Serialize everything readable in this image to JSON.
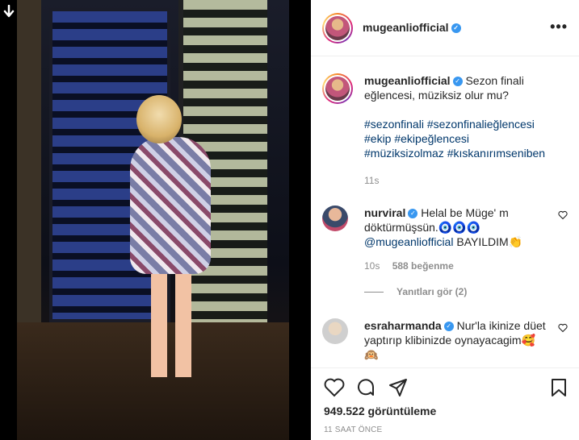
{
  "post": {
    "username": "mugeanliofficial",
    "more_label": "•••"
  },
  "caption": {
    "username": "mugeanliofficial",
    "text": "Sezon finali eğlencesi, müziksiz olur mu?",
    "hashtags": "#sezonfinali #sezonfinalieğlencesi #ekip #ekipeğlencesi #müziksizolmaz #kıskanırımseniben",
    "time": "11s"
  },
  "comments": [
    {
      "username": "nurviral",
      "text": "Helal be Müge' m döktürmüşsün.🧿🧿🧿",
      "mention": "@mugeanliofficial",
      "text2": "BAYILDIM👏",
      "time": "10s",
      "likes": "588 beğenme",
      "replies": "Yanıtları gör (2)"
    },
    {
      "username": "esraharmanda",
      "text": "Nur'la ikinize düet yaptırıp klibinizde oynayacagim🥰🙉"
    }
  ],
  "stats": {
    "views": "949.522 görüntüleme",
    "time_ago": "11 SAAT ÖNCE"
  },
  "icons": {
    "download": "arrow-down-icon",
    "like": "heart-icon",
    "comment": "comment-icon",
    "share": "share-icon",
    "save": "bookmark-icon"
  },
  "colors": {
    "link": "#00376b",
    "verified": "#3897f0",
    "muted": "#8e8e8e"
  }
}
